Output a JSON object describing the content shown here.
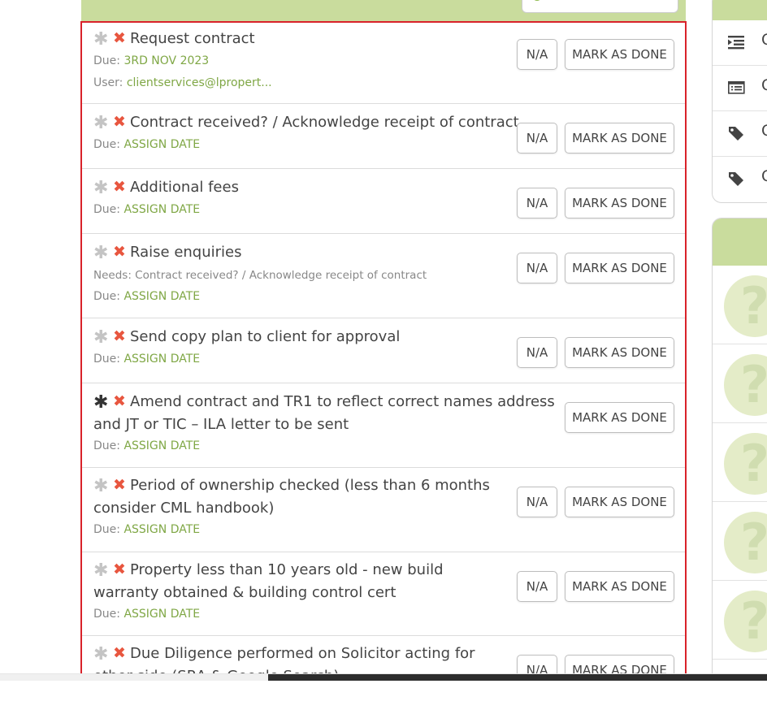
{
  "tasks": [
    {
      "title": "Request contract",
      "lines": [
        {
          "label": "Due: ",
          "value": "3RD NOV 2023"
        },
        {
          "label": "User: ",
          "value": "clientservices@lpropert..."
        }
      ],
      "na_label": "N/A",
      "done_label": "MARK AS DONE"
    },
    {
      "title": "Contract received? / Acknowledge receipt of contract",
      "lines": [
        {
          "label": "Due: ",
          "value": "ASSIGN DATE"
        }
      ],
      "na_label": "N/A",
      "done_label": "MARK AS DONE"
    },
    {
      "title": "Additional fees",
      "lines": [
        {
          "label": "Due: ",
          "value": "ASSIGN DATE"
        }
      ],
      "na_label": "N/A",
      "done_label": "MARK AS DONE"
    },
    {
      "title": "Raise enquiries",
      "lines": [
        {
          "label": "Needs: Contract received? / Acknowledge receipt of contract",
          "value": ""
        },
        {
          "label": "Due: ",
          "value": "ASSIGN DATE"
        }
      ],
      "na_label": "N/A",
      "done_label": "MARK AS DONE"
    },
    {
      "title": "Send copy plan to client for approval",
      "lines": [
        {
          "label": "Due: ",
          "value": "ASSIGN DATE"
        }
      ],
      "na_label": "N/A",
      "done_label": "MARK AS DONE"
    },
    {
      "title": "Amend contract and TR1 to reflect correct names address and JT or TIC – ILA letter to be sent",
      "lines": [
        {
          "label": "Due: ",
          "value": "ASSIGN DATE"
        }
      ],
      "done_label": "MARK AS DONE"
    },
    {
      "title": "Period of ownership checked (less than 6 months consider CML handbook)",
      "lines": [
        {
          "label": "Due: ",
          "value": "ASSIGN DATE"
        }
      ],
      "na_label": "N/A",
      "done_label": "MARK AS DONE"
    },
    {
      "title": "Property less than 10 years old - new build warranty obtained & building control cert",
      "lines": [
        {
          "label": "Due: ",
          "value": "ASSIGN DATE"
        }
      ],
      "na_label": "N/A",
      "done_label": "MARK AS DONE"
    },
    {
      "title": "Due Diligence performed on Solicitor acting for other side (SRA & Google Search)",
      "lines": [],
      "na_label": "N/A",
      "done_label": "MARK AS DONE"
    }
  ],
  "sidebar": {
    "items": [
      {
        "icon": "indent-icon",
        "letter": "C"
      },
      {
        "icon": "list-icon",
        "letter": "C"
      },
      {
        "icon": "tag-icon",
        "letter": "C"
      },
      {
        "icon": "tag-icon",
        "letter": "C"
      }
    ]
  },
  "help": {
    "items": [
      "?",
      "?",
      "?",
      "?",
      "?"
    ]
  },
  "colors": {
    "accent_green": "#c9dc9d",
    "value_green": "#7fa745",
    "cross_red": "#e8563f",
    "highlight_border": "#d9222a"
  }
}
